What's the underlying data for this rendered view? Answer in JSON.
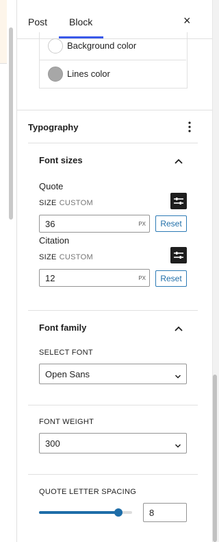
{
  "tabs": [
    {
      "label": "Post"
    },
    {
      "label": "Block"
    }
  ],
  "close_label": "×",
  "colors": [
    {
      "label": "Background color",
      "swatch": "#ffffff"
    },
    {
      "label": "Lines color",
      "swatch": "#a7a7a7"
    }
  ],
  "typography": {
    "title": "Typography",
    "font_sizes": {
      "title": "Font sizes",
      "items": [
        {
          "name": "Quote",
          "size_label": "SIZE",
          "size_mode": "CUSTOM",
          "value": "36",
          "unit": "PX",
          "reset": "Reset"
        },
        {
          "name": "Citation",
          "size_label": "SIZE",
          "size_mode": "CUSTOM",
          "value": "12",
          "unit": "PX",
          "reset": "Reset"
        }
      ]
    },
    "font_family": {
      "title": "Font family",
      "select_label": "SELECT FONT",
      "select_value": "Open Sans"
    },
    "font_weight": {
      "label": "FONT WEIGHT",
      "value": "300"
    },
    "letter_spacing": {
      "label": "QUOTE LETTER SPACING",
      "value": "8",
      "fraction": 0.85
    }
  },
  "accent": "#1e6da8",
  "tab_indicator": "#3858e9"
}
